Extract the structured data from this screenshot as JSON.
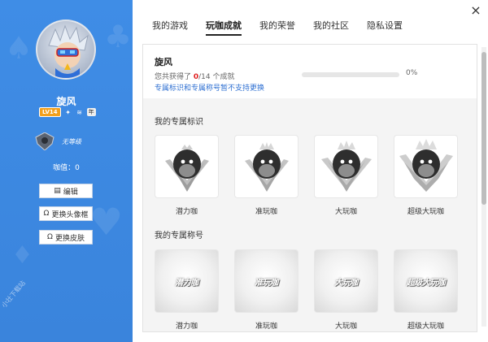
{
  "sidebar": {
    "username": "旋风",
    "level_badge": "LV14",
    "nian_badge": "年",
    "rank_text": "无等级",
    "coffee_label": "咖值：0",
    "buttons": {
      "edit": "编辑",
      "change_avatar_frame": "更换头像框",
      "change_skin": "更换皮肤"
    },
    "watermark": "小壮下载站"
  },
  "tabs": [
    {
      "label": "我的游戏",
      "active": false
    },
    {
      "label": "玩咖成就",
      "active": true
    },
    {
      "label": "我的荣誉",
      "active": false
    },
    {
      "label": "我的社区",
      "active": false
    },
    {
      "label": "隐私设置",
      "active": false
    }
  ],
  "close_icon": "×",
  "summary": {
    "name": "旋风",
    "count_prefix": "您共获得了 ",
    "count_value": "0",
    "count_suffix": "/14 个成就",
    "note": "专属标识和专属称号暂不支持更换",
    "progress_percent": 0,
    "progress_label": "0%"
  },
  "section_badges": {
    "title": "我的专属标识",
    "items": [
      {
        "label": "潜力咖"
      },
      {
        "label": "准玩咖"
      },
      {
        "label": "大玩咖"
      },
      {
        "label": "超级大玩咖"
      }
    ]
  },
  "section_titles": {
    "title": "我的专属称号",
    "items": [
      {
        "label": "潜力咖",
        "badge_text": "潜力咖"
      },
      {
        "label": "准玩咖",
        "badge_text": "准玩咖"
      },
      {
        "label": "大玩咖",
        "badge_text": "大玩咖"
      },
      {
        "label": "超级大玩咖",
        "badge_text": "超级大玩咖"
      }
    ]
  },
  "colors": {
    "sidebar_bg": "#3f8de6",
    "accent_blue": "#2d6fd2",
    "accent_red": "#e02020"
  }
}
